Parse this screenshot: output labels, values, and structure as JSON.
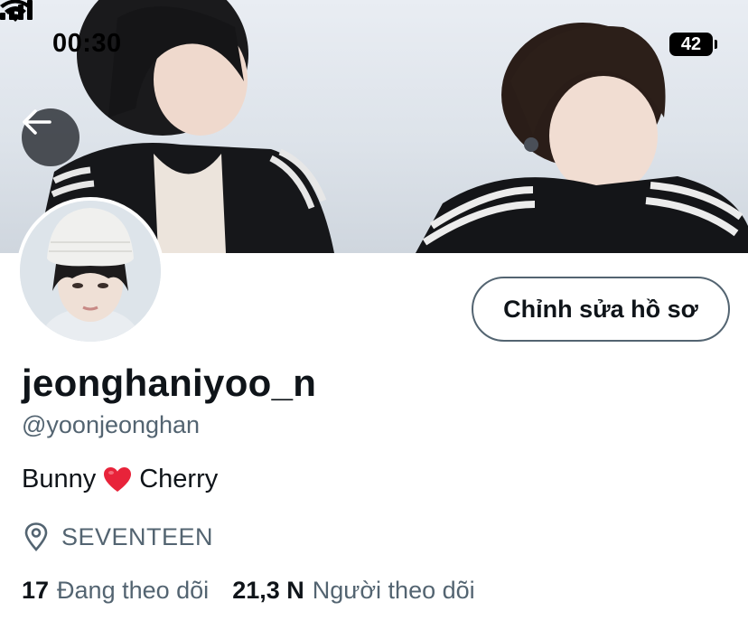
{
  "status_bar": {
    "time": "00:30",
    "battery": "42"
  },
  "header": {
    "back_icon": "arrow-left-icon"
  },
  "profile": {
    "edit_button_label": "Chỉnh sửa hồ sơ",
    "display_name": "jeonghaniyoo_n",
    "handle": "@yoonjeonghan",
    "bio_before": "Bunny",
    "bio_emoji": "heart-icon",
    "bio_after": "Cherry",
    "location": "SEVENTEEN",
    "location_icon": "location-pin-icon"
  },
  "stats": {
    "following_count": "17",
    "following_label": "Đang theo dõi",
    "followers_count": "21,3 N",
    "followers_label": "Người theo dõi"
  },
  "colors": {
    "primary_text": "#0f1419",
    "secondary_text": "#536471",
    "heart": "#e8233a"
  }
}
